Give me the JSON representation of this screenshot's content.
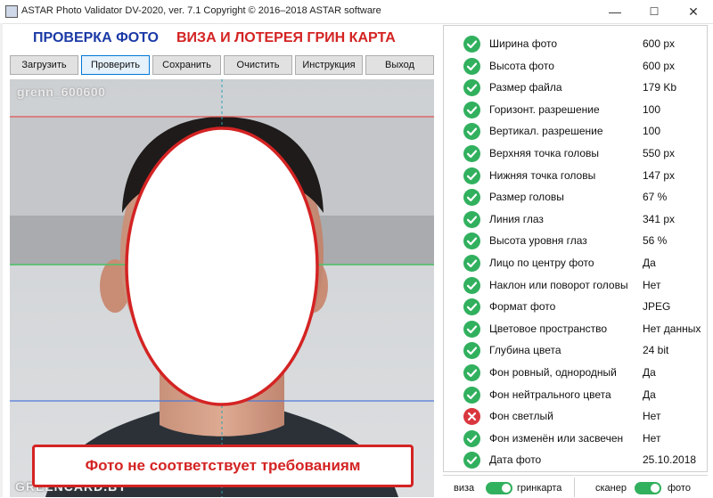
{
  "window": {
    "title": "ASTAR Photo Validator DV-2020, ver. 7.1  Copyright © 2016–2018 ASTAR software",
    "controls": {
      "minimize": "—",
      "maximize": "☐",
      "close": "✕"
    }
  },
  "header": {
    "title_blue": "ПРОВЕРКА ФОТО",
    "title_red": "ВИЗА И ЛОТЕРЕЯ ГРИН КАРТА"
  },
  "toolbar": {
    "buttons": [
      "Загрузить",
      "Проверить",
      "Сохранить",
      "Очистить",
      "Инструкция",
      "Выход"
    ],
    "active_index": 1
  },
  "photo": {
    "label": "grenn_600600",
    "watermark": "GREENCARD.BY",
    "status": "Фото не соответствует требованиям"
  },
  "checks": [
    {
      "label": "Ширина фото",
      "value": "600 px",
      "ok": true
    },
    {
      "label": "Высота фото",
      "value": "600 px",
      "ok": true
    },
    {
      "label": "Размер файла",
      "value": "179 Kb",
      "ok": true
    },
    {
      "label": "Горизонт. разрешение",
      "value": "100",
      "ok": true
    },
    {
      "label": "Вертикал. разрешение",
      "value": "100",
      "ok": true
    },
    {
      "label": "Верхняя точка головы",
      "value": "550 px",
      "ok": true
    },
    {
      "label": "Нижняя точка головы",
      "value": "147 px",
      "ok": true
    },
    {
      "label": "Размер головы",
      "value": "67 %",
      "ok": true
    },
    {
      "label": "Линия глаз",
      "value": "341 px",
      "ok": true
    },
    {
      "label": "Высота уровня глаз",
      "value": "56 %",
      "ok": true
    },
    {
      "label": "Лицо по центру фото",
      "value": "Да",
      "ok": true
    },
    {
      "label": "Наклон или поворот головы",
      "value": "Нет",
      "ok": true
    },
    {
      "label": "Формат фото",
      "value": "JPEG",
      "ok": true
    },
    {
      "label": "Цветовое пространство",
      "value": "Нет данных",
      "ok": true
    },
    {
      "label": "Глубина цвета",
      "value": "24 bit",
      "ok": true
    },
    {
      "label": "Фон ровный, однородный",
      "value": "Да",
      "ok": true
    },
    {
      "label": "Фон нейтрального цвета",
      "value": "Да",
      "ok": true
    },
    {
      "label": "Фон светлый",
      "value": "Нет",
      "ok": false
    },
    {
      "label": "Фон изменён или засвечен",
      "value": "Нет",
      "ok": true
    },
    {
      "label": "Дата фото",
      "value": "25.10.2018",
      "ok": true
    }
  ],
  "footer": {
    "left_label": "виза",
    "left_mode": "гринкарта",
    "right_label": "сканер",
    "right_mode": "фото"
  },
  "colors": {
    "ok": "#31b05e",
    "fail": "#d9363e",
    "heading_blue": "#1b3aa6",
    "heading_red": "#d42323",
    "guide_red": "#e05656",
    "guide_green": "#4cc46a",
    "guide_blue": "#4f79d8",
    "guide_center": "#2aa3b8"
  }
}
